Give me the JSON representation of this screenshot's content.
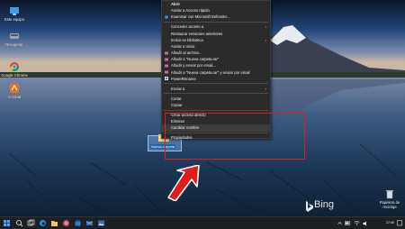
{
  "desktop_icons": [
    {
      "label": "Este equipo",
      "icon": "computer-icon"
    },
    {
      "label": "Recuperar",
      "icon": "disk-icon"
    },
    {
      "label": "Google Chrome",
      "icon": "chrome-icon"
    },
    {
      "label": "Acrobat",
      "icon": "acrobat-icon"
    },
    {
      "label": "Papelera de reciclaje",
      "icon": "recycle-bin-icon"
    }
  ],
  "context_menu": {
    "items": [
      {
        "label": "Abrir",
        "bold": true
      },
      {
        "label": "Anclar a Acceso rápido"
      },
      {
        "label": "Examinar con Microsoft Defender...",
        "icon": "defender-icon"
      },
      {
        "sep": true
      },
      {
        "label": "Conceder acceso a",
        "submenu": true
      },
      {
        "label": "Restaurar versiones anteriores"
      },
      {
        "label": "Incluir en biblioteca",
        "submenu": true
      },
      {
        "label": "Anclar a Inicio"
      },
      {
        "label": "Añadir al archivo...",
        "icon": "winrar-icon"
      },
      {
        "label": "Añadir a \"Nueva carpeta.rar\"",
        "icon": "winrar-icon"
      },
      {
        "label": "Añadir y enviar por email...",
        "icon": "winrar-icon"
      },
      {
        "label": "Añadir a \"Nueva carpeta.rar\" y enviar por email",
        "icon": "winrar-icon"
      },
      {
        "label": "PowerRename",
        "icon": "powerrename-icon"
      },
      {
        "sep": true
      },
      {
        "label": "Enviar a",
        "submenu": true
      },
      {
        "sep": true
      },
      {
        "label": "Cortar"
      },
      {
        "label": "Copiar"
      },
      {
        "sep": true
      },
      {
        "label": "Crear acceso directo"
      },
      {
        "label": "Eliminar"
      },
      {
        "label": "Cambiar nombre"
      },
      {
        "sep": true
      },
      {
        "label": "Propiedades"
      }
    ],
    "submenu_arrow": "›"
  },
  "folder": {
    "name": "Nueva carpeta"
  },
  "bing": {
    "label": "Bing"
  },
  "taskbar": {
    "time": "17:40",
    "date": "",
    "pinned": [
      "start-icon",
      "search-icon",
      "task-view-icon",
      "edge-icon",
      "explorer-icon",
      "chrome-icon",
      "store-icon",
      "mail-icon",
      "photos-icon"
    ]
  },
  "colors": {
    "menu_bg": "#2b2b2b",
    "highlight_box": "#e21b1b",
    "arrow": "#e21b1b",
    "taskbar": "#1c1f24"
  }
}
